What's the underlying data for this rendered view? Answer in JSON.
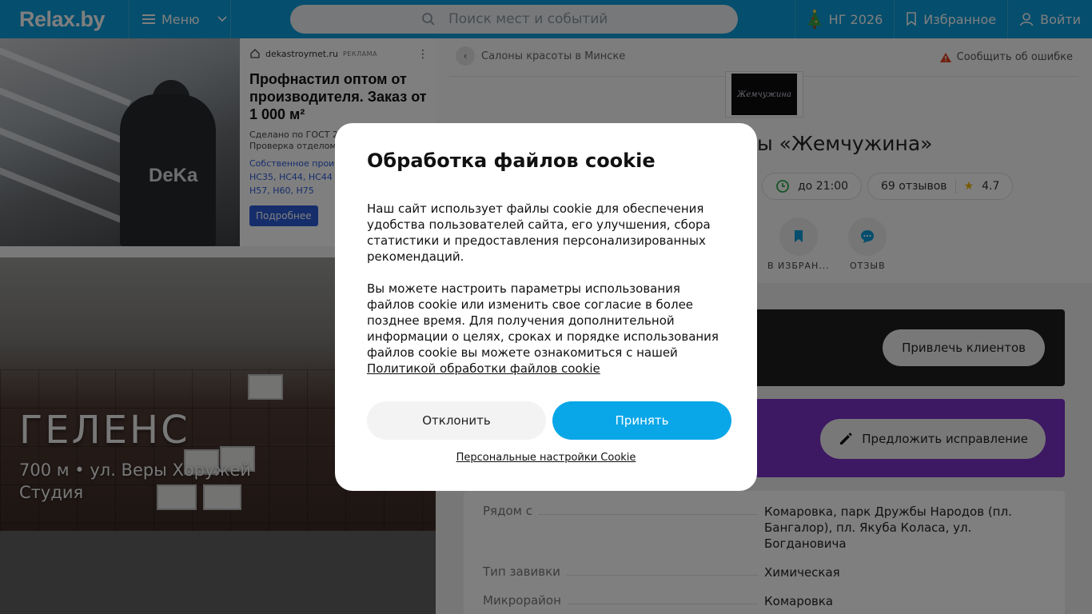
{
  "header": {
    "logo": "Relax.by",
    "menu": "Меню",
    "search_placeholder": "Поиск мест и событий",
    "ng": "НГ 2026",
    "favorites": "Избранное",
    "login": "Войти"
  },
  "ad": {
    "source": "dekastroymet.ru",
    "tag": "РЕКЛАМА",
    "title": "Профнастил оптом от производителя. Заказ от 1 000 м²",
    "desc": "Сделано по ГОСТ 24045-2016. Проверка отделом качества. Даём гарантию на продукцию",
    "link": "Собственное производство. НС35, НС44, НС44 Н57, Н60, Н75",
    "link_l1": "Собственное произв",
    "link_l2": "НС35, НС44, НС44 Н",
    "link_l3": "Н57, Н60, Н75",
    "button": "Подробнее",
    "photo_text": "DeKa"
  },
  "card": {
    "title": "ГЕЛЕНС",
    "distance_street": "700 м • ул. Веры Хоружей",
    "type": "Студия"
  },
  "breadcrumb": "Салоны красоты в Минске",
  "report": "Сообщить об ошибке",
  "salon": {
    "logo_text": "Жемчужина",
    "title_visible": "ы «Жемчужина»",
    "hours": "до 21:00",
    "reviews": "69 отзывов",
    "rating": "4.7"
  },
  "actions": {
    "favorite": "В ИЗБРАН...",
    "review": "ОТЗЫВ"
  },
  "promo": {
    "attract": "Привлечь клиентов",
    "suggest": "Предложить исправление"
  },
  "info": [
    {
      "k": "Рядом с",
      "v": "Комаровка, парк Дружбы Народов (пл. Бангалор), пл. Якуба Коласа, ул. Богдановича"
    },
    {
      "k": "Тип завивки",
      "v": "Химическая"
    },
    {
      "k": "Микрорайон",
      "v": "Комаровка"
    }
  ],
  "cookie": {
    "title": "Обработка файлов cookie",
    "p1": "Наш сайт использует файлы cookie для обеспечения удобства пользователей сайта, его улучшения, сбора статистики и предоставления персонализированных рекомендаций.",
    "p2": "Вы можете настроить параметры использования файлов cookie или изменить свое согласие в более позднее время. Для получения дополнительной информации о целях, сроках и порядке использования файлов cookie вы можете ознакомиться с нашей",
    "policy_link": "Политикой обработки файлов cookie",
    "decline": "Отклонить",
    "accept": "Принять",
    "personal": "Персональные настройки Cookie"
  },
  "colors": {
    "header": "#0a9cdb",
    "accept": "#0aa7e8",
    "promo_purple": "#7b30c6",
    "ad_button": "#2a5bd7"
  }
}
